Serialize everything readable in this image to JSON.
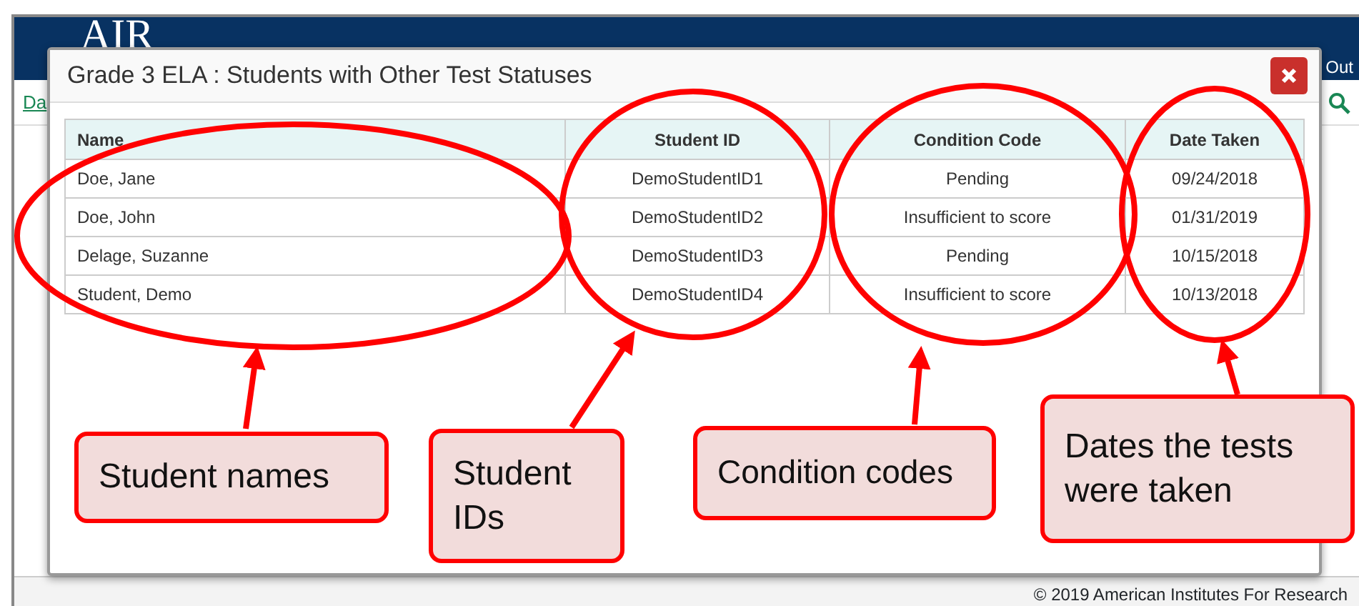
{
  "page": {
    "logo_text": "AIR",
    "header_link": "Out",
    "nav_link": "Da",
    "footer": "© 2019 American Institutes For Research"
  },
  "modal": {
    "title": "Grade 3 ELA : Students with Other Test Statuses",
    "table": {
      "columns": [
        "Name",
        "Student ID",
        "Condition Code",
        "Date Taken"
      ],
      "rows": [
        [
          "Doe, Jane",
          "DemoStudentID1",
          "Pending",
          "09/24/2018"
        ],
        [
          "Doe, John",
          "DemoStudentID2",
          "Insufficient to score",
          "01/31/2019"
        ],
        [
          "Delage, Suzanne",
          "DemoStudentID3",
          "Pending",
          "10/15/2018"
        ],
        [
          "Student, Demo",
          "DemoStudentID4",
          "Insufficient to score",
          "10/13/2018"
        ]
      ]
    }
  },
  "annotations": [
    {
      "text": "Student names"
    },
    {
      "text": "Student IDs"
    },
    {
      "text": "Condition codes"
    },
    {
      "text": "Dates the tests were taken"
    }
  ]
}
